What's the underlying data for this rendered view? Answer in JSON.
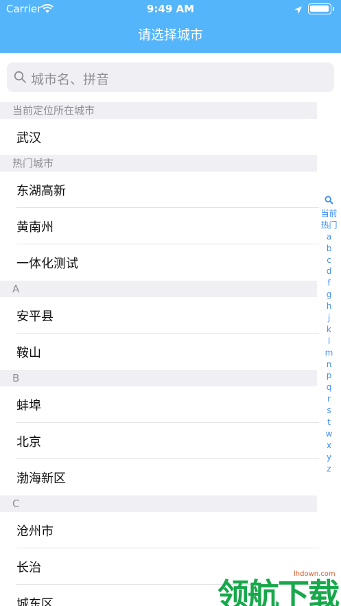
{
  "status": {
    "carrier": "Carrier",
    "time": "9:49 AM"
  },
  "nav": {
    "title": "请选择城市"
  },
  "search": {
    "placeholder": "城市名、拼音"
  },
  "sections": [
    {
      "header": "当前定位所在城市",
      "items": [
        "武汉"
      ]
    },
    {
      "header": "热门城市",
      "items": [
        "东湖高新",
        "黄南州",
        "一体化测试"
      ]
    },
    {
      "header": "A",
      "items": [
        "安平县",
        "鞍山"
      ]
    },
    {
      "header": "B",
      "items": [
        "蚌埠",
        "北京",
        "渤海新区"
      ]
    },
    {
      "header": "C",
      "items": [
        "沧州市",
        "长治",
        "城东区"
      ]
    }
  ],
  "index_bar": [
    "当前",
    "热门",
    "a",
    "b",
    "c",
    "d",
    "f",
    "g",
    "h",
    "j",
    "k",
    "l",
    "m",
    "n",
    "p",
    "q",
    "r",
    "s",
    "t",
    "w",
    "x",
    "y",
    "z"
  ],
  "watermark": {
    "text": "领航下载",
    "url": "lhdown.com"
  },
  "colors": {
    "nav_bg": "#55b5fb",
    "index": "#3c8ef6",
    "watermark": "#17a84b"
  }
}
